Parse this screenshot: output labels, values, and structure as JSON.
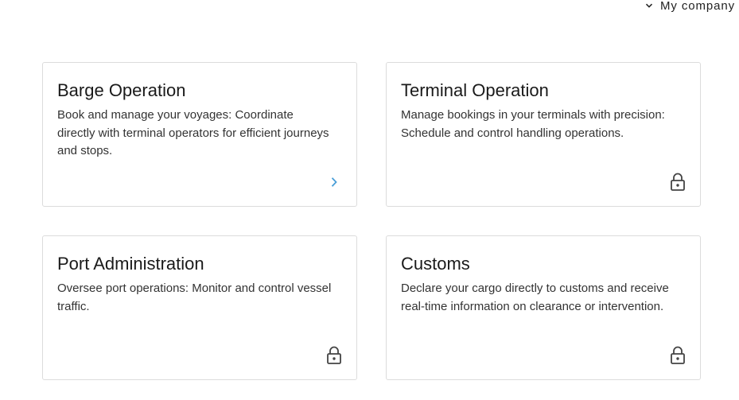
{
  "header": {
    "company_label": "My company",
    "company_icon": "chevron-down-icon"
  },
  "cards": [
    {
      "title": "Barge Operation",
      "description": "Book and manage your voyages: Coordinate directly with terminal operators for efficient journeys and stops.",
      "icon": "chevron-right-icon",
      "locked": false,
      "icon_color": "#4a9fd8"
    },
    {
      "title": "Terminal Operation",
      "description": "Manage bookings in your terminals with precision: Schedule and control handling operations.",
      "icon": "lock-icon",
      "locked": true,
      "icon_color": "#444444"
    },
    {
      "title": "Port Administration",
      "description": "Oversee port operations: Monitor and control vessel traffic.",
      "icon": "lock-icon",
      "locked": true,
      "icon_color": "#444444"
    },
    {
      "title": "Customs",
      "description": "Declare your cargo directly to customs and receive real-time information on clearance or intervention.",
      "icon": "lock-icon",
      "locked": true,
      "icon_color": "#444444"
    }
  ]
}
